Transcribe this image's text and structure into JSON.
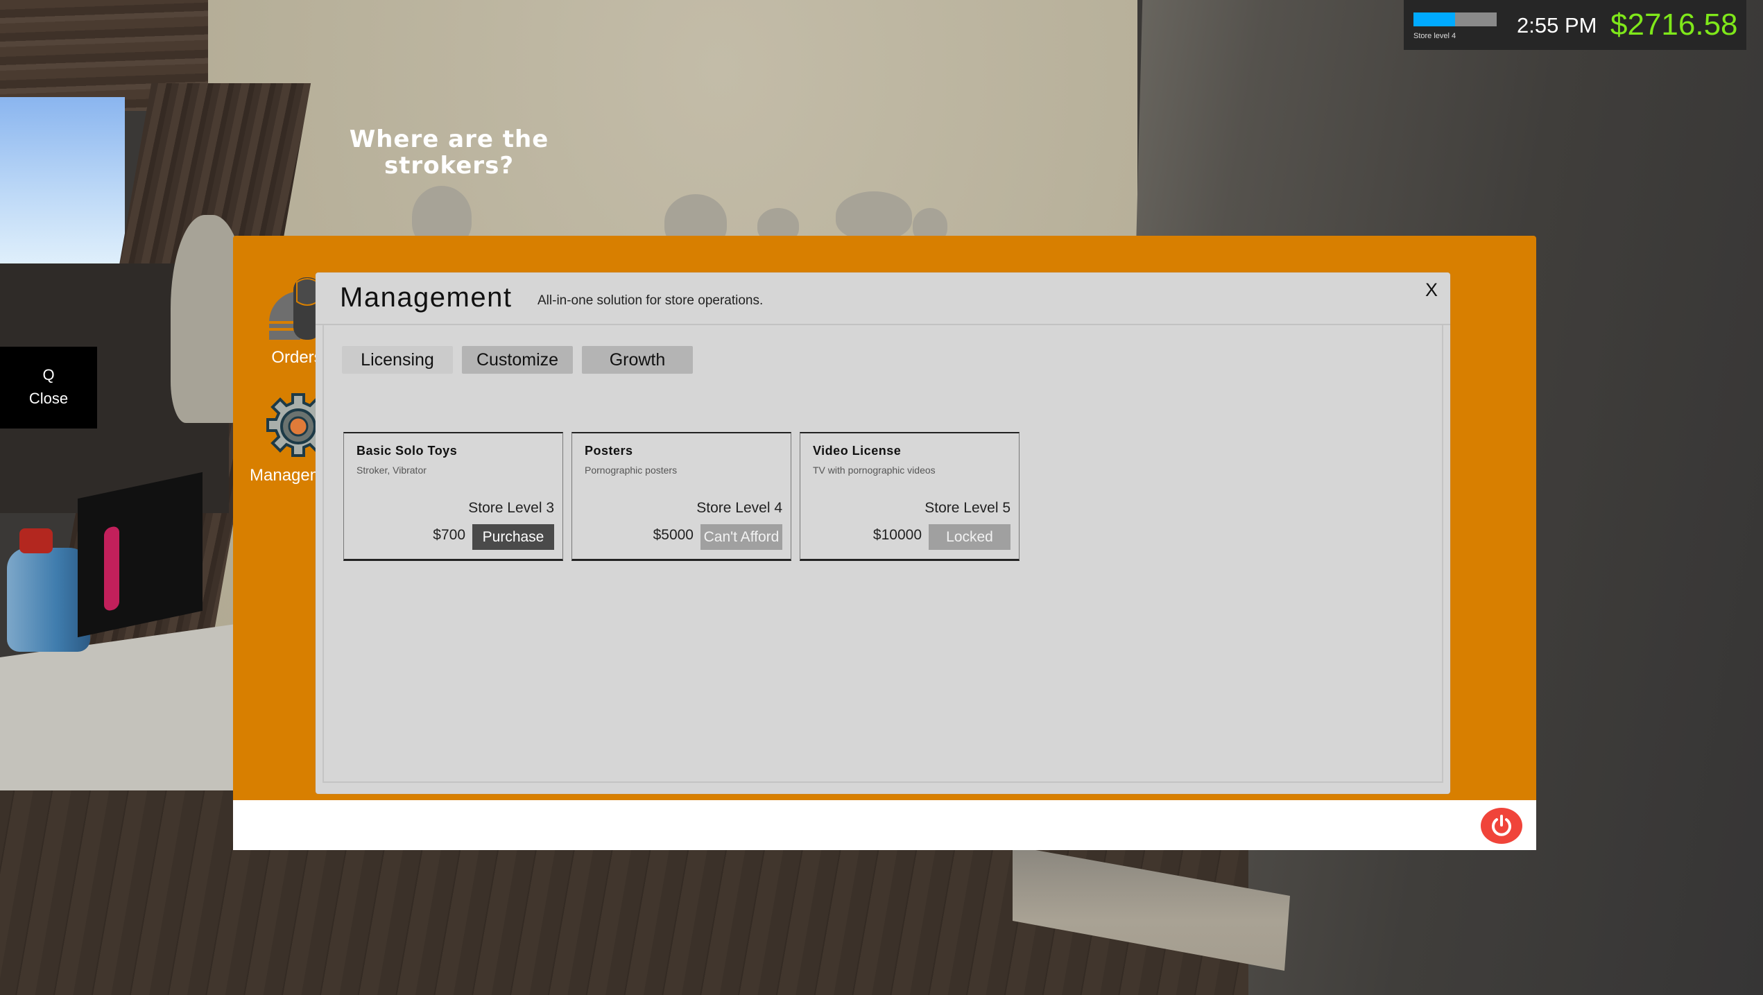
{
  "scene": {
    "speech_bubble": "Where are the strokers?"
  },
  "hint": {
    "key": "Q",
    "label": "Close"
  },
  "hud": {
    "store_level_label": "Store level 4",
    "store_level_progress": 0.5,
    "time": "2:55 PM",
    "money": "$2716.58",
    "progress_color": "#00aaff",
    "money_color": "#7fe81a"
  },
  "desktop": {
    "icons": [
      {
        "label": "Orders",
        "icon": "orders-icon"
      },
      {
        "label": "Management",
        "icon": "gear-icon"
      }
    ],
    "frame_color": "#d87f00"
  },
  "window": {
    "title": "Management",
    "subtitle": "All-in-one solution for store operations.",
    "close_label": "X",
    "tabs": [
      {
        "label": "Licensing",
        "selected": false
      },
      {
        "label": "Customize",
        "selected": true
      },
      {
        "label": "Growth",
        "selected": true
      }
    ],
    "items": [
      {
        "name": "Basic Solo Toys",
        "description": "Stroker, Vibrator",
        "requirement": "Store Level 3",
        "price": "$700",
        "action": "Purchase",
        "state": "available"
      },
      {
        "name": "Posters",
        "description": "Pornographic posters",
        "requirement": "Store Level 4",
        "price": "$5000",
        "action": "Can't Afford",
        "state": "unaffordable"
      },
      {
        "name": "Video License",
        "description": "TV with pornographic videos",
        "requirement": "Store Level 5",
        "price": "$10000",
        "action": "Locked",
        "state": "locked"
      }
    ]
  },
  "taskbar": {
    "power_icon": "power-icon",
    "power_color": "#f0443a"
  }
}
